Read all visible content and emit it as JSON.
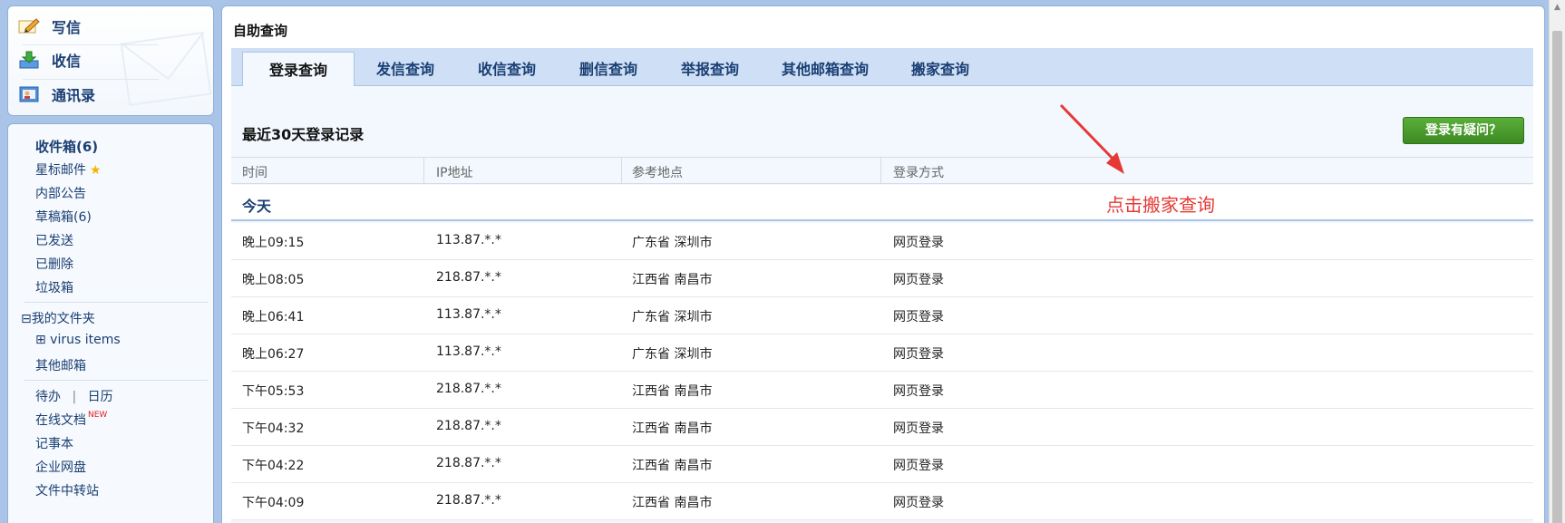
{
  "actions": [
    {
      "label": "写信",
      "icon": "compose-icon"
    },
    {
      "label": "收信",
      "icon": "receive-icon"
    },
    {
      "label": "通讯录",
      "icon": "address-book-icon"
    }
  ],
  "nav": {
    "inbox": "收件箱(6)",
    "starred": "星标邮件",
    "announcements": "内部公告",
    "drafts": "草稿箱(6)",
    "sent": "已发送",
    "deleted": "已删除",
    "trash": "垃圾箱",
    "my_folders": "⊟我的文件夹",
    "virus_items": "⊞ virus items",
    "other_mailbox": "其他邮箱",
    "todo": "待办",
    "divider": "|",
    "calendar": "日历",
    "online_docs": "在线文档",
    "new_tag": "NEW",
    "notebook": "记事本",
    "enterprise_disk": "企业网盘",
    "file_transfer": "文件中转站"
  },
  "main": {
    "title": "自助查询",
    "tabs": [
      "登录查询",
      "发信查询",
      "收信查询",
      "删信查询",
      "举报查询",
      "其他邮箱查询",
      "搬家查询"
    ],
    "section_title": "最近30天登录记录",
    "help_button": "登录有疑问？",
    "columns": [
      "时间",
      "IP地址",
      "参考地点",
      "登录方式"
    ],
    "group_label": "今天",
    "rows": [
      {
        "time": "晚上09:15",
        "ip": "113.87.*.*",
        "location": "广东省 深圳市",
        "method": "网页登录"
      },
      {
        "time": "晚上08:05",
        "ip": "218.87.*.*",
        "location": "江西省 南昌市",
        "method": "网页登录"
      },
      {
        "time": "晚上06:41",
        "ip": "113.87.*.*",
        "location": "广东省 深圳市",
        "method": "网页登录"
      },
      {
        "time": "晚上06:27",
        "ip": "113.87.*.*",
        "location": "广东省 深圳市",
        "method": "网页登录"
      },
      {
        "time": "下午05:53",
        "ip": "218.87.*.*",
        "location": "江西省 南昌市",
        "method": "网页登录"
      },
      {
        "time": "下午04:32",
        "ip": "218.87.*.*",
        "location": "江西省 南昌市",
        "method": "网页登录"
      },
      {
        "time": "下午04:22",
        "ip": "218.87.*.*",
        "location": "江西省 南昌市",
        "method": "网页登录"
      },
      {
        "time": "下午04:09",
        "ip": "218.87.*.*",
        "location": "江西省 南昌市",
        "method": "网页登录"
      }
    ]
  },
  "annotation": {
    "text": "点击搬家查询",
    "color": "#e53935"
  }
}
